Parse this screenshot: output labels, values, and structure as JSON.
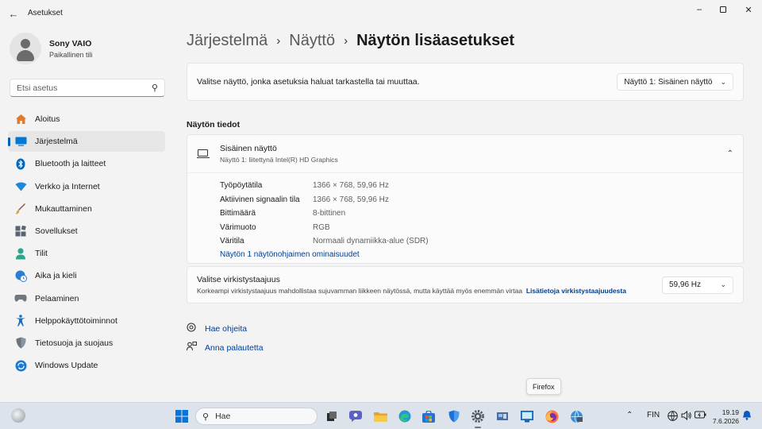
{
  "window": {
    "app_title": "Asetukset",
    "back_icon": "arrow-left-icon",
    "controls": [
      "minimize-icon",
      "maximize-icon",
      "close-icon"
    ]
  },
  "profile": {
    "name": "Sony VAIO",
    "subtitle": "Paikallinen tili"
  },
  "search": {
    "placeholder": "Etsi asetus"
  },
  "sidebar": {
    "items": [
      {
        "label": "Aloitus",
        "icon": "home-icon",
        "active": false
      },
      {
        "label": "Järjestelmä",
        "icon": "system-icon",
        "active": true
      },
      {
        "label": "Bluetooth ja laitteet",
        "icon": "bluetooth-icon",
        "active": false
      },
      {
        "label": "Verkko ja Internet",
        "icon": "wifi-icon",
        "active": false
      },
      {
        "label": "Mukauttaminen",
        "icon": "brush-icon",
        "active": false
      },
      {
        "label": "Sovellukset",
        "icon": "apps-icon",
        "active": false
      },
      {
        "label": "Tilit",
        "icon": "account-icon",
        "active": false
      },
      {
        "label": "Aika ja kieli",
        "icon": "globe-clock-icon",
        "active": false
      },
      {
        "label": "Pelaaminen",
        "icon": "gamepad-icon",
        "active": false
      },
      {
        "label": "Helppokäyttötoiminnot",
        "icon": "accessibility-icon",
        "active": false
      },
      {
        "label": "Tietosuoja ja suojaus",
        "icon": "shield-icon",
        "active": false
      },
      {
        "label": "Windows Update",
        "icon": "update-icon",
        "active": false
      }
    ]
  },
  "breadcrumb": {
    "items": [
      "Järjestelmä",
      "Näyttö"
    ],
    "current": "Näytön lisäasetukset"
  },
  "select_display": {
    "label": "Valitse näyttö, jonka asetuksia haluat tarkastella tai muuttaa.",
    "selected": "Näyttö 1: Sisäinen näyttö"
  },
  "display_info": {
    "section_title": "Näytön tiedot",
    "name": "Sisäinen näyttö",
    "connection": "Näyttö 1: liitettynä Intel(R) HD Graphics",
    "rows": [
      {
        "key": "Työpöytätila",
        "value": "1366 × 768, 59,96 Hz"
      },
      {
        "key": "Aktiivinen signaalin tila",
        "value": "1366 × 768, 59,96 Hz"
      },
      {
        "key": "Bittimäärä",
        "value": "8-bittinen"
      },
      {
        "key": "Värimuoto",
        "value": "RGB"
      },
      {
        "key": "Väritila",
        "value": "Normaali dynamiikka-alue (SDR)"
      }
    ],
    "adapter_link": "Näytön 1 näytönohjaimen ominaisuudet"
  },
  "refresh_rate": {
    "title": "Valitse virkistystaajuus",
    "description": "Korkeampi virkistystaajuus mahdollistaa sujuvamman liikkeen näytössä, mutta käyttää myös enemmän virtaa",
    "link": "Lisätietoja virkistystaajuudesta",
    "selected": "59,96 Hz"
  },
  "help": {
    "get_help": "Hae ohjeita",
    "feedback": "Anna palautetta"
  },
  "tooltip": "Firefox",
  "taskbar": {
    "search_placeholder": "Hae",
    "language": "FIN",
    "time": "19.19",
    "date": "7.6.2026",
    "pinned": [
      "start-icon",
      "task-view-icon",
      "chat-icon",
      "file-explorer-icon",
      "edge-icon",
      "store-icon",
      "defender-icon",
      "settings-icon",
      "control-panel-icon",
      "remote-desktop-icon",
      "firefox-icon",
      "network-globe-icon"
    ]
  }
}
